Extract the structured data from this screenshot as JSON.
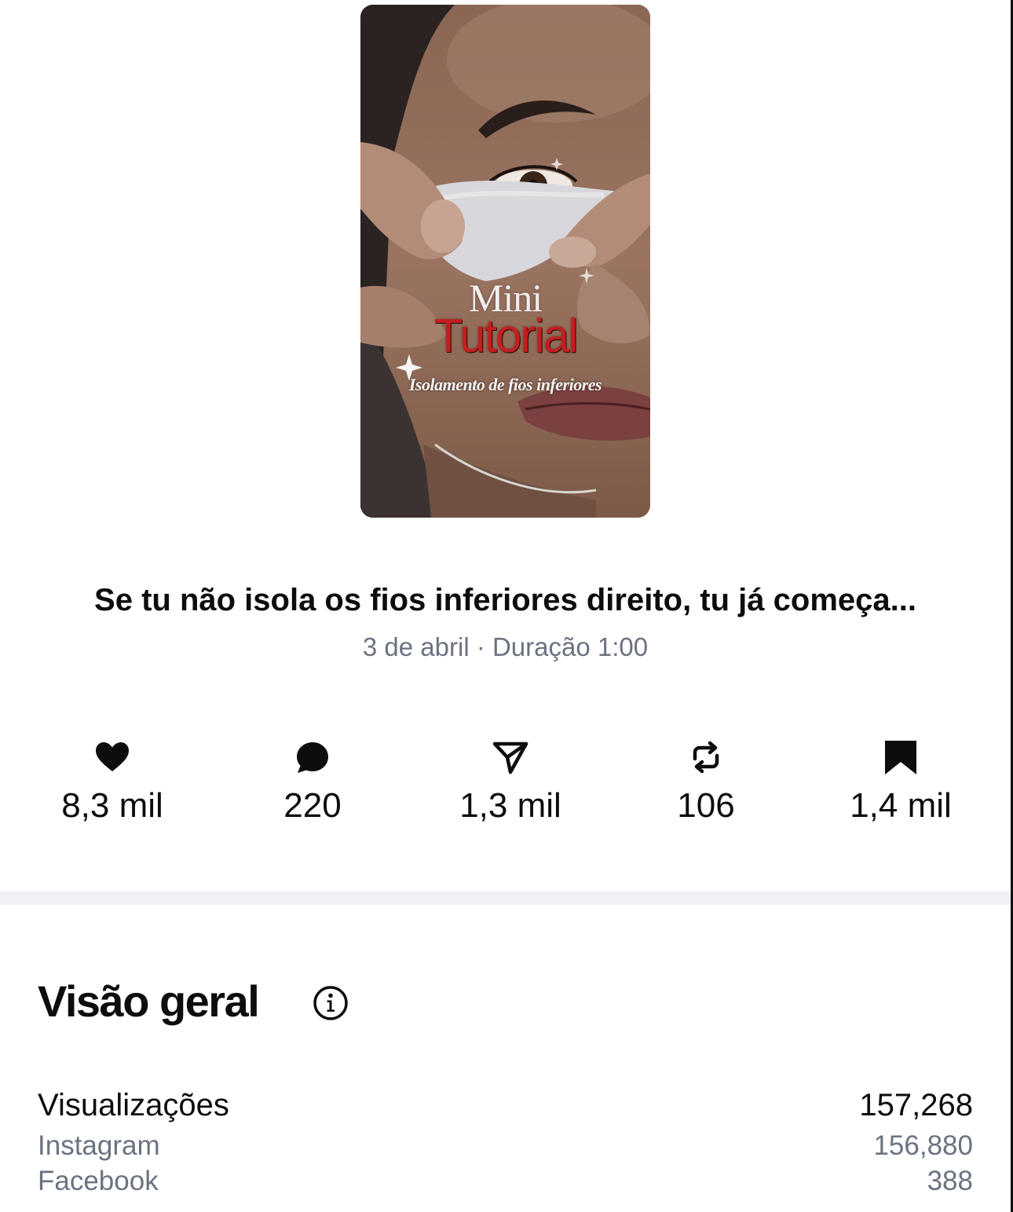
{
  "post": {
    "thumbnail": {
      "overlay_line1": "Mini",
      "overlay_line2": "Tutorial",
      "overlay_subtitle": "Isolamento de fios inferiores"
    },
    "caption": "Se tu não isola os fios inferiores direito, tu já começa...",
    "meta": "3 de abril · Duração 1:00"
  },
  "stats": [
    {
      "icon": "heart-icon",
      "value": "8,3 mil"
    },
    {
      "icon": "comment-icon",
      "value": "220"
    },
    {
      "icon": "share-icon",
      "value": "1,3 mil"
    },
    {
      "icon": "repost-icon",
      "value": "106"
    },
    {
      "icon": "bookmark-icon",
      "value": "1,4 mil"
    }
  ],
  "overview": {
    "title": "Visão geral",
    "info_icon": "info-icon",
    "rows": [
      {
        "label": "Visualizações",
        "value": "157,268"
      },
      {
        "label": "Instagram",
        "value": "156,880"
      },
      {
        "label": "Facebook",
        "value": "388"
      }
    ]
  },
  "colors": {
    "text": "#0d0d0d",
    "muted": "#6b7280",
    "divider": "#eff1f4",
    "tutorial_red": "#c41e1e"
  }
}
